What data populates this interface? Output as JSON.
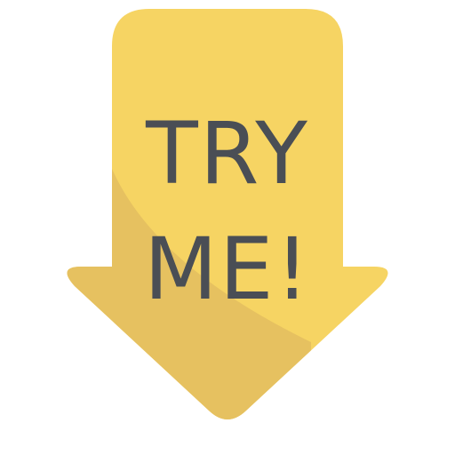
{
  "sign": {
    "line1": "TRY",
    "line2": "ME!",
    "colors": {
      "arrow_fill": "#f6d463",
      "arrow_shadow": "#e6c160",
      "text": "#4a4e55"
    }
  }
}
